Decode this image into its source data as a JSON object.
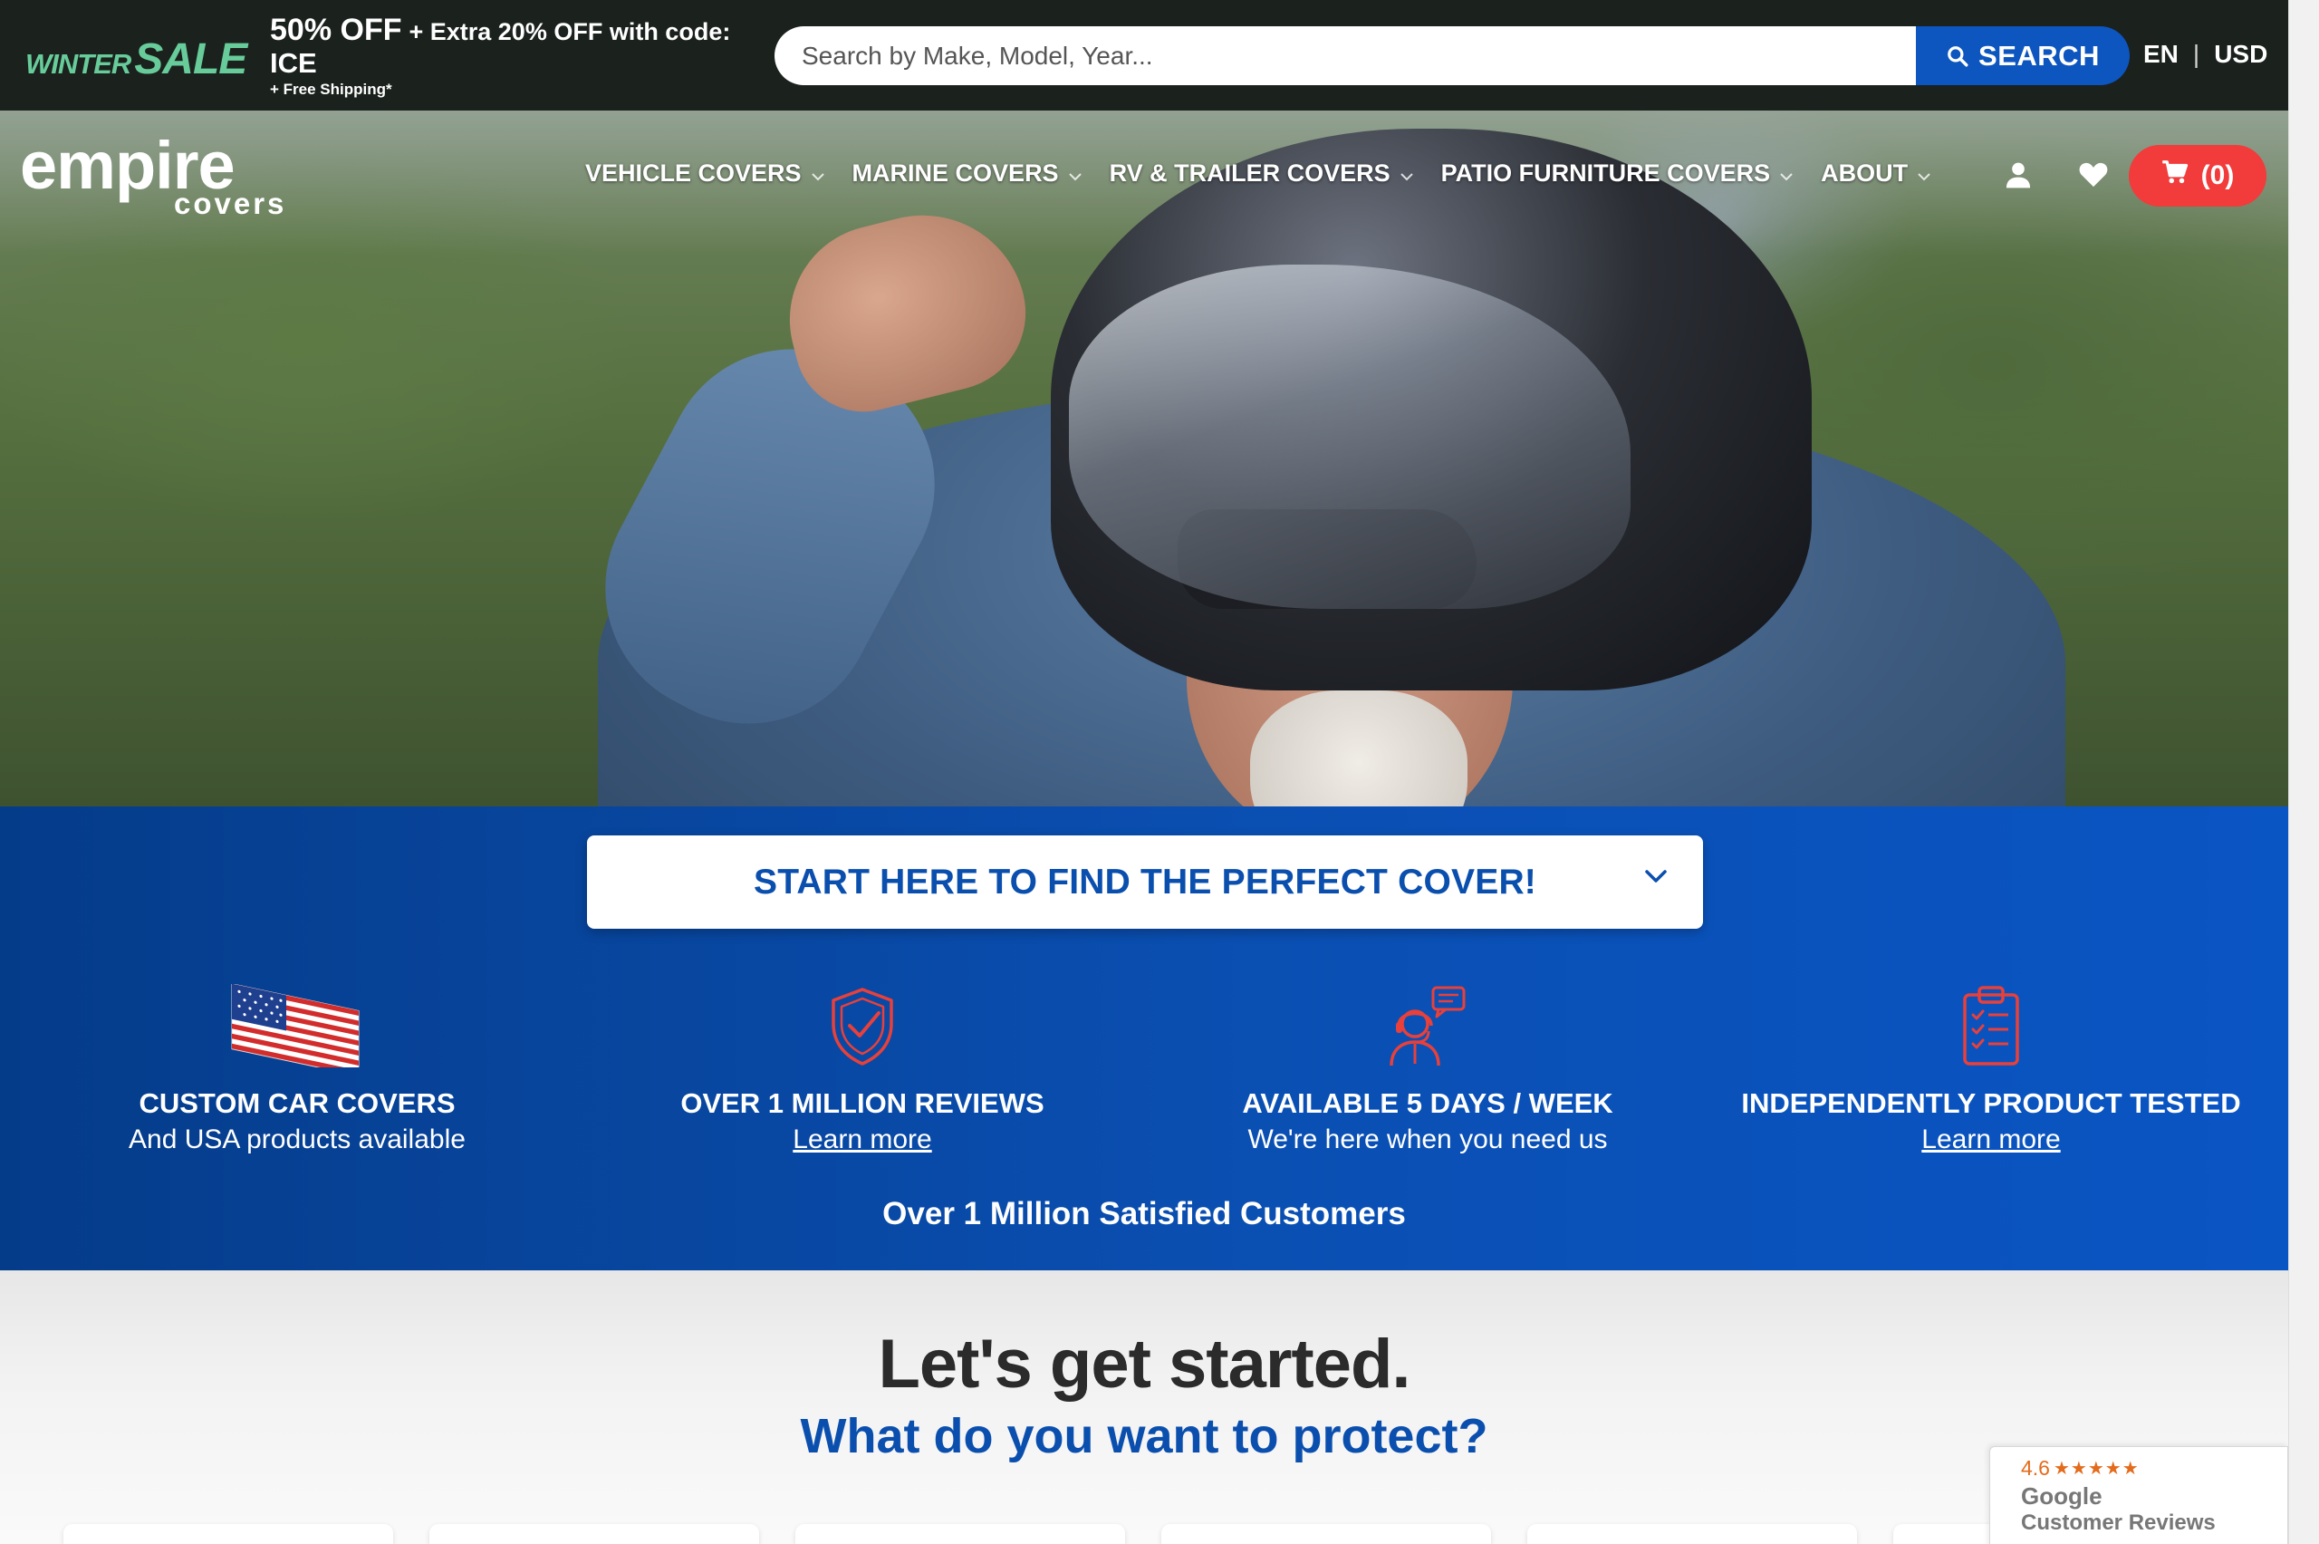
{
  "promo": {
    "winter": "WINTER",
    "sale": "SALE",
    "discount": "50% OFF",
    "extra": "+ Extra 20% OFF with code:",
    "code": "ICE",
    "shipping": "+ Free Shipping*"
  },
  "search": {
    "placeholder": "Search by Make, Model, Year...",
    "button_label": "SEARCH"
  },
  "locale": {
    "language": "EN",
    "separator": "|",
    "currency": "USD"
  },
  "logo": {
    "main": "empire",
    "sub": "covers"
  },
  "nav": {
    "items": [
      {
        "label": "VEHICLE COVERS"
      },
      {
        "label": "MARINE COVERS"
      },
      {
        "label": "RV & TRAILER COVERS"
      },
      {
        "label": "PATIO FURNITURE COVERS"
      },
      {
        "label": "ABOUT"
      }
    ],
    "cart_label": "(0)"
  },
  "finder": {
    "label": "START HERE TO FIND THE PERFECT COVER!"
  },
  "features": [
    {
      "title": "CUSTOM CAR COVERS",
      "subtitle": "And USA products available",
      "icon": "usa-flag-icon"
    },
    {
      "title": "OVER 1 MILLION REVIEWS",
      "link": "Learn more",
      "icon": "shield-check-icon"
    },
    {
      "title": "AVAILABLE 5 DAYS / WEEK",
      "subtitle": "We're here when you need us",
      "icon": "support-agent-icon"
    },
    {
      "title": "INDEPENDENTLY PRODUCT TESTED",
      "link": "Learn more",
      "icon": "clipboard-check-icon"
    }
  ],
  "satisfied": "Over 1 Million Satisfied Customers",
  "start": {
    "title": "Let's get started.",
    "subtitle": "What do you want to protect?"
  },
  "review_badge": {
    "score": "4.6",
    "stars": "★★★★★",
    "brand": "Google",
    "label": "Customer Reviews"
  },
  "colors": {
    "top_bar": "#1b211d",
    "sale_green": "#67cc9a",
    "brand_blue": "#0b4fae",
    "search_blue": "#0d55bf",
    "cart_red": "#f23b3b",
    "icon_red": "#e8403a"
  }
}
